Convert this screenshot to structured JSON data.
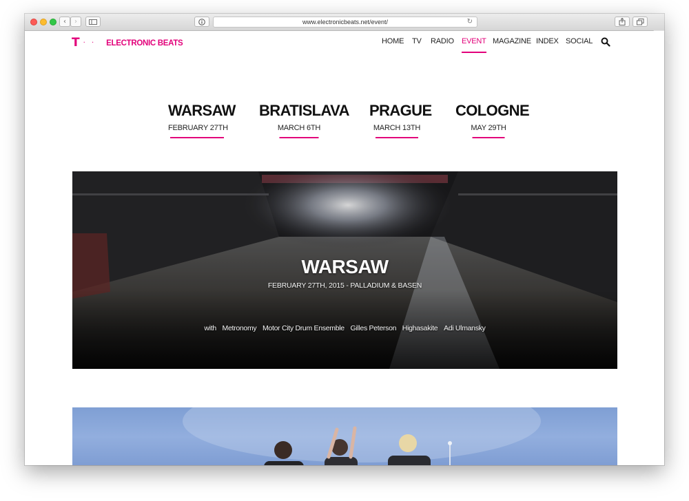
{
  "browser": {
    "url": "www.electronicbeats.net/event/",
    "new_tab_label": "+"
  },
  "site": {
    "logo_mark": "T",
    "logo_dots": "· ·",
    "logo_text": "ELECTRONIC BEATS"
  },
  "nav": {
    "items": [
      {
        "label": "HOME",
        "active": false
      },
      {
        "label": "TV",
        "active": false
      },
      {
        "label": "RADIO",
        "active": false
      },
      {
        "label": "EVENT",
        "active": true
      },
      {
        "label": "MAGAZINE",
        "active": false
      },
      {
        "label": "INDEX",
        "active": false
      },
      {
        "label": "SOCIAL",
        "active": false
      }
    ]
  },
  "cities": [
    {
      "name": "WARSAW",
      "date": "FEBRUARY 27TH"
    },
    {
      "name": "BRATISLAVA",
      "date": "MARCH 6TH"
    },
    {
      "name": "PRAGUE",
      "date": "MARCH 13TH"
    },
    {
      "name": "COLOGNE",
      "date": "MAY 29TH"
    }
  ],
  "hero": {
    "title": "WARSAW",
    "subtitle": "FEBRUARY 27TH, 2015 - PALLADIUM & BASEN",
    "lineup_prefix": "with",
    "lineup": [
      "Metronomy",
      "Motor City Drum Ensemble",
      "Gilles Peterson",
      "Highasakite",
      "Adi Ulmansky"
    ]
  },
  "colors": {
    "accent": "#e2007a"
  },
  "icons": {
    "search": "search-icon",
    "back": "chevron-left-icon",
    "forward": "chevron-right-icon",
    "sidebar": "sidebar-icon",
    "info": "info-icon",
    "reload": "reload-icon",
    "share": "share-icon",
    "tabs": "tabs-icon"
  }
}
